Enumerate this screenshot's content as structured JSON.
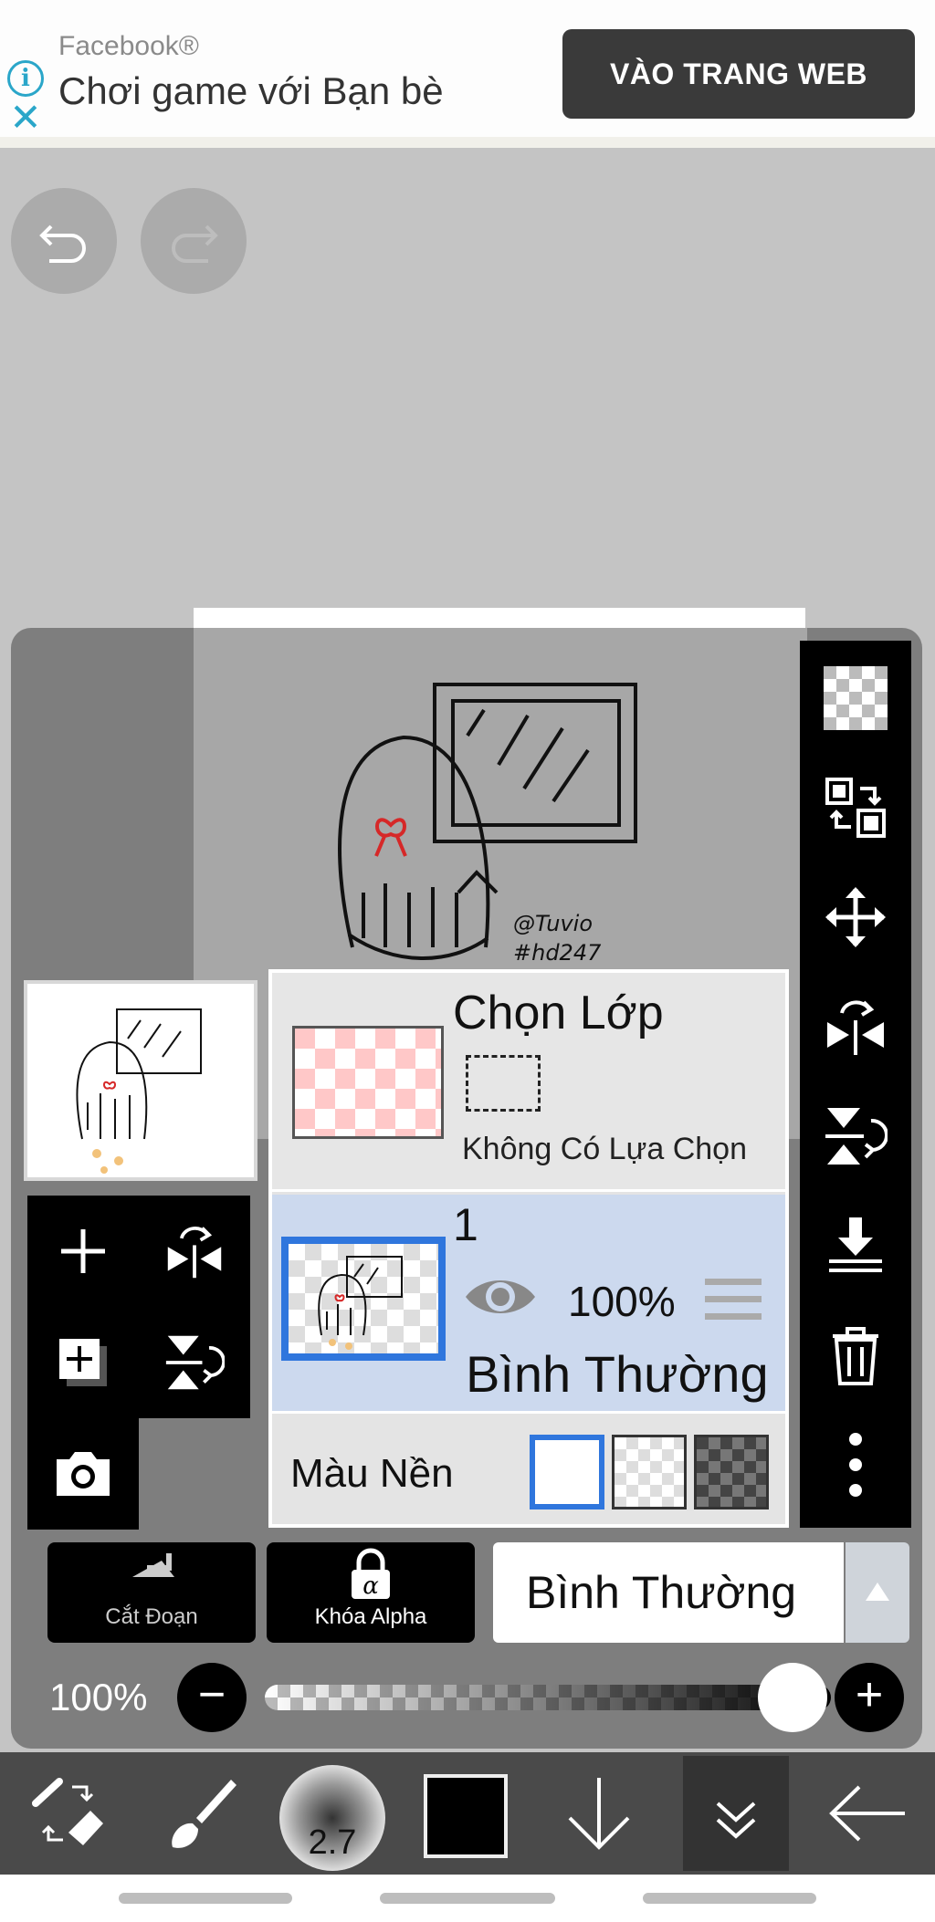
{
  "ad": {
    "source": "Facebook®",
    "title": "Chơi game với Bạn bè",
    "cta": "VÀO TRANG WEB"
  },
  "layer_panel": {
    "selection_layer": {
      "title": "Chọn Lớp",
      "status": "Không Có Lựa Chọn"
    },
    "layers": [
      {
        "number": "1",
        "opacity": "100%",
        "blend_mode": "Bình Thường",
        "visible": true
      }
    ],
    "background": {
      "label": "Màu Nền",
      "options": [
        "white",
        "checker-light",
        "checker-dark"
      ],
      "selected": "white"
    }
  },
  "actions": {
    "clipping": "Cắt Đoạn",
    "alpha_lock": "Khóa Alpha",
    "blend_mode": "Bình Thường"
  },
  "opacity": {
    "label": "100%",
    "value": 1.0
  },
  "toolbar": {
    "brush_size": "2.7",
    "color": "#000000"
  },
  "colors": {
    "accent": "#2f76dd",
    "panel": "#7e7e7e",
    "selected_layer": "#ccd9ee"
  }
}
